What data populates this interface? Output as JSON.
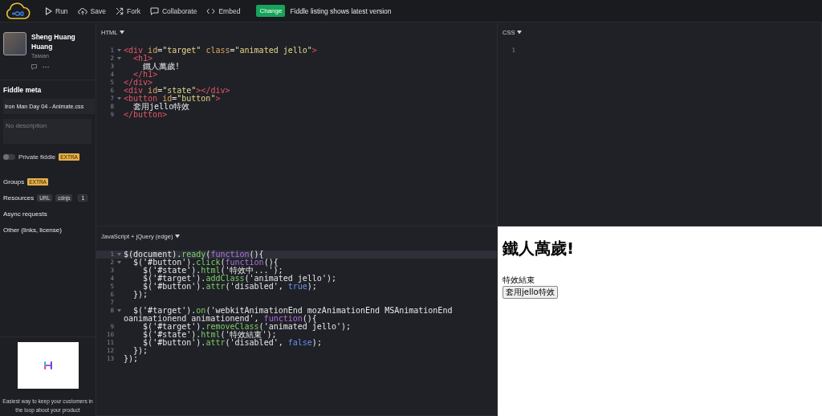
{
  "toolbar": {
    "actions": [
      {
        "kind": "run",
        "label": "Run"
      },
      {
        "kind": "save",
        "label": "Save"
      },
      {
        "kind": "fork",
        "label": "Fork"
      },
      {
        "kind": "collaborate",
        "label": "Collaborate"
      },
      {
        "kind": "embed",
        "label": "Embed"
      }
    ],
    "change_button": "Change",
    "notice": "Fiddle listing shows latest version"
  },
  "sidebar": {
    "author": {
      "name": "Sheng Huang Huang",
      "location": "Taiwan"
    },
    "meta": {
      "heading": "Fiddle meta",
      "title_value": "Iron Man Day 04 - Animate.css",
      "description_placeholder": "No description",
      "private": {
        "label": "Private fiddle",
        "on": false,
        "badge": "EXTRA"
      }
    },
    "sections": [
      {
        "kind": "badge",
        "label": "Groups",
        "badge": "EXTRA"
      },
      {
        "kind": "tags",
        "label": "Resources",
        "tags": [
          "URL",
          "cdnjs"
        ],
        "count": "1"
      },
      {
        "kind": "plain",
        "label": "Async requests"
      },
      {
        "kind": "plain",
        "label": "Other (links, license)"
      }
    ],
    "ad": {
      "text": "Easiest way to keep your customers in the loop about your product"
    }
  },
  "editors": {
    "html": {
      "label": "HTML",
      "lines": [
        {
          "number": "1",
          "fold": true,
          "tokens": [
            {
              "kind": "tag",
              "text": "<div"
            },
            {
              "kind": "attr",
              "text": " id"
            },
            {
              "kind": "text",
              "text": "="
            },
            {
              "kind": "str",
              "text": "\"target\""
            },
            {
              "kind": "attr",
              "text": " class"
            },
            {
              "kind": "text",
              "text": "="
            },
            {
              "kind": "str",
              "text": "\"animated jello\""
            },
            {
              "kind": "tag",
              "text": ">"
            }
          ]
        },
        {
          "number": "2",
          "fold": true,
          "tokens": [
            {
              "kind": "tag",
              "text": "  <h1>"
            }
          ]
        },
        {
          "number": "3",
          "fold": false,
          "tokens": [
            {
              "kind": "text",
              "text": "    鐵人萬歲!"
            }
          ]
        },
        {
          "number": "4",
          "fold": false,
          "tokens": [
            {
              "kind": "tag",
              "text": "  </h1>"
            }
          ]
        },
        {
          "number": "5",
          "fold": false,
          "tokens": [
            {
              "kind": "tag",
              "text": "</div>"
            }
          ]
        },
        {
          "number": "6",
          "fold": false,
          "tokens": [
            {
              "kind": "tag",
              "text": "<div"
            },
            {
              "kind": "attr",
              "text": " id"
            },
            {
              "kind": "text",
              "text": "="
            },
            {
              "kind": "str",
              "text": "\"state\""
            },
            {
              "kind": "tag",
              "text": "></div>"
            }
          ]
        },
        {
          "number": "7",
          "fold": true,
          "tokens": [
            {
              "kind": "tag",
              "text": "<button"
            },
            {
              "kind": "attr",
              "text": " id"
            },
            {
              "kind": "text",
              "text": "="
            },
            {
              "kind": "str",
              "text": "\"button\""
            },
            {
              "kind": "tag",
              "text": ">"
            }
          ]
        },
        {
          "number": "8",
          "fold": false,
          "tokens": [
            {
              "kind": "text",
              "text": "  套用jello特效"
            }
          ]
        },
        {
          "number": "9",
          "fold": false,
          "tokens": [
            {
              "kind": "tag",
              "text": "</button>"
            }
          ]
        }
      ]
    },
    "css": {
      "label": "CSS",
      "lines": [
        {
          "number": "1",
          "fold": false
        }
      ]
    },
    "js": {
      "label": "JavaScript + jQuery (edge)",
      "lines": [
        {
          "number": "1",
          "fold": true,
          "active": true,
          "tokens": [
            {
              "kind": "text",
              "text": "$(document)."
            },
            {
              "kind": "fn",
              "text": "ready"
            },
            {
              "kind": "text",
              "text": "("
            },
            {
              "kind": "kw",
              "text": "function"
            },
            {
              "kind": "text",
              "text": "(){"
            }
          ]
        },
        {
          "number": "2",
          "fold": true,
          "active": false,
          "tokens": [
            {
              "kind": "text",
              "text": "  $('#button')."
            },
            {
              "kind": "fn",
              "text": "click"
            },
            {
              "kind": "text",
              "text": "("
            },
            {
              "kind": "kw",
              "text": "function"
            },
            {
              "kind": "text",
              "text": "(){"
            }
          ]
        },
        {
          "number": "3",
          "fold": false,
          "active": false,
          "tokens": [
            {
              "kind": "text",
              "text": "    $('#state')."
            },
            {
              "kind": "fn",
              "text": "html"
            },
            {
              "kind": "text",
              "text": "('特效中...');"
            }
          ]
        },
        {
          "number": "4",
          "fold": false,
          "active": false,
          "tokens": [
            {
              "kind": "text",
              "text": "    $('#target')."
            },
            {
              "kind": "fn",
              "text": "addClass"
            },
            {
              "kind": "text",
              "text": "('animated jello');"
            }
          ]
        },
        {
          "number": "5",
          "fold": false,
          "active": false,
          "tokens": [
            {
              "kind": "text",
              "text": "    $('#button')."
            },
            {
              "kind": "fn",
              "text": "attr"
            },
            {
              "kind": "text",
              "text": "('disabled', "
            },
            {
              "kind": "bool",
              "text": "true"
            },
            {
              "kind": "text",
              "text": ");"
            }
          ]
        },
        {
          "number": "6",
          "fold": false,
          "active": false,
          "tokens": [
            {
              "kind": "text",
              "text": "  });"
            }
          ]
        },
        {
          "number": "7",
          "fold": false,
          "active": false
        },
        {
          "number": "8",
          "fold": true,
          "active": false,
          "tokens": [
            {
              "kind": "text",
              "text": "  $('#target')."
            },
            {
              "kind": "fn",
              "text": "on"
            },
            {
              "kind": "text",
              "text": "('webkitAnimationEnd mozAnimationEnd MSAnimationEnd oanimationend animationend', "
            },
            {
              "kind": "kw",
              "text": "function"
            },
            {
              "kind": "text",
              "text": "(){"
            }
          ]
        },
        {
          "number": "9",
          "fold": false,
          "active": false,
          "tokens": [
            {
              "kind": "text",
              "text": "    $('#target')."
            },
            {
              "kind": "fn",
              "text": "removeClass"
            },
            {
              "kind": "text",
              "text": "('animated jello');"
            }
          ]
        },
        {
          "number": "10",
          "fold": false,
          "active": false,
          "tokens": [
            {
              "kind": "text",
              "text": "    $('#state')."
            },
            {
              "kind": "fn",
              "text": "html"
            },
            {
              "kind": "text",
              "text": "('特效結束');"
            }
          ]
        },
        {
          "number": "11",
          "fold": false,
          "active": false,
          "tokens": [
            {
              "kind": "text",
              "text": "    $('#button')."
            },
            {
              "kind": "fn",
              "text": "attr"
            },
            {
              "kind": "text",
              "text": "('disabled', "
            },
            {
              "kind": "bool",
              "text": "false"
            },
            {
              "kind": "text",
              "text": ");"
            }
          ]
        },
        {
          "number": "12",
          "fold": false,
          "active": false,
          "tokens": [
            {
              "kind": "text",
              "text": "  });"
            }
          ]
        },
        {
          "number": "13",
          "fold": false,
          "active": false,
          "tokens": [
            {
              "kind": "text",
              "text": "});"
            }
          ]
        }
      ]
    }
  },
  "result": {
    "heading": "鐵人萬歲!",
    "state_text": "特效結束",
    "button": "套用jello特效"
  }
}
